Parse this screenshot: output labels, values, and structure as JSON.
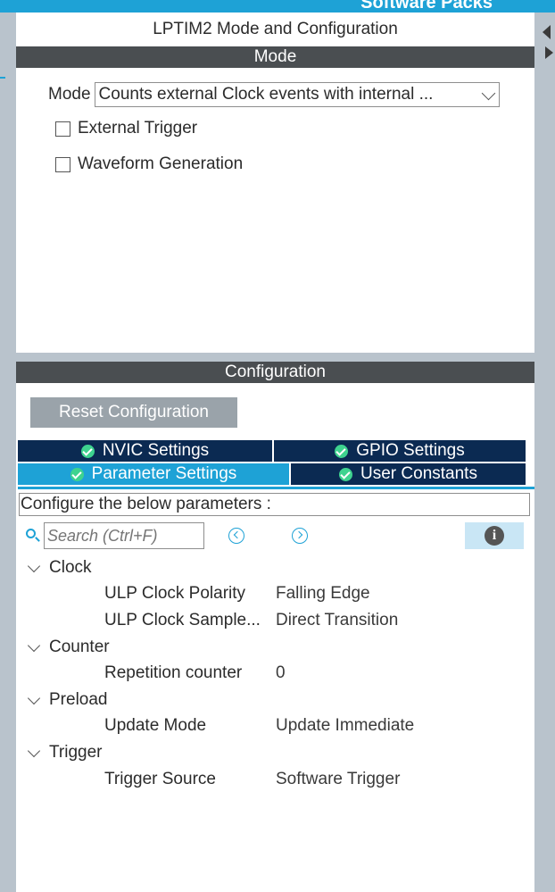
{
  "header": {
    "software_packs": "Software Packs"
  },
  "mode_panel": {
    "title": "LPTIM2 Mode and Configuration",
    "section_label": "Mode",
    "mode_label": "Mode",
    "mode_value": "Counts external Clock events with internal ...",
    "checkboxes": [
      {
        "label": "External Trigger",
        "checked": false
      },
      {
        "label": "Waveform Generation",
        "checked": false
      }
    ]
  },
  "config_panel": {
    "section_label": "Configuration",
    "reset_label": "Reset Configuration",
    "tabs": [
      {
        "label": "NVIC Settings",
        "active": false
      },
      {
        "label": "GPIO Settings",
        "active": false
      },
      {
        "label": "Parameter Settings",
        "active": true
      },
      {
        "label": "User Constants",
        "active": false
      }
    ],
    "description": "Configure the below parameters :",
    "search_placeholder": "Search (Ctrl+F)"
  },
  "parameters": {
    "groups": [
      {
        "label": "Clock"
      },
      {
        "label": "Counter"
      },
      {
        "label": "Preload"
      },
      {
        "label": "Trigger"
      }
    ],
    "rows": [
      {
        "name": "ULP Clock Polarity",
        "value": "Falling Edge"
      },
      {
        "name": "ULP Clock Sample...",
        "value": "Direct Transition"
      },
      {
        "name": "Repetition counter",
        "value": "0"
      },
      {
        "name": "Update Mode",
        "value": "Update Immediate"
      },
      {
        "name": "Trigger Source",
        "value": "Software Trigger"
      }
    ]
  },
  "colors": {
    "accent": "#1ea2d6",
    "header_gray": "#4a4e51",
    "tab_dark": "#0b2a52",
    "ok_green": "#3ed38f"
  }
}
